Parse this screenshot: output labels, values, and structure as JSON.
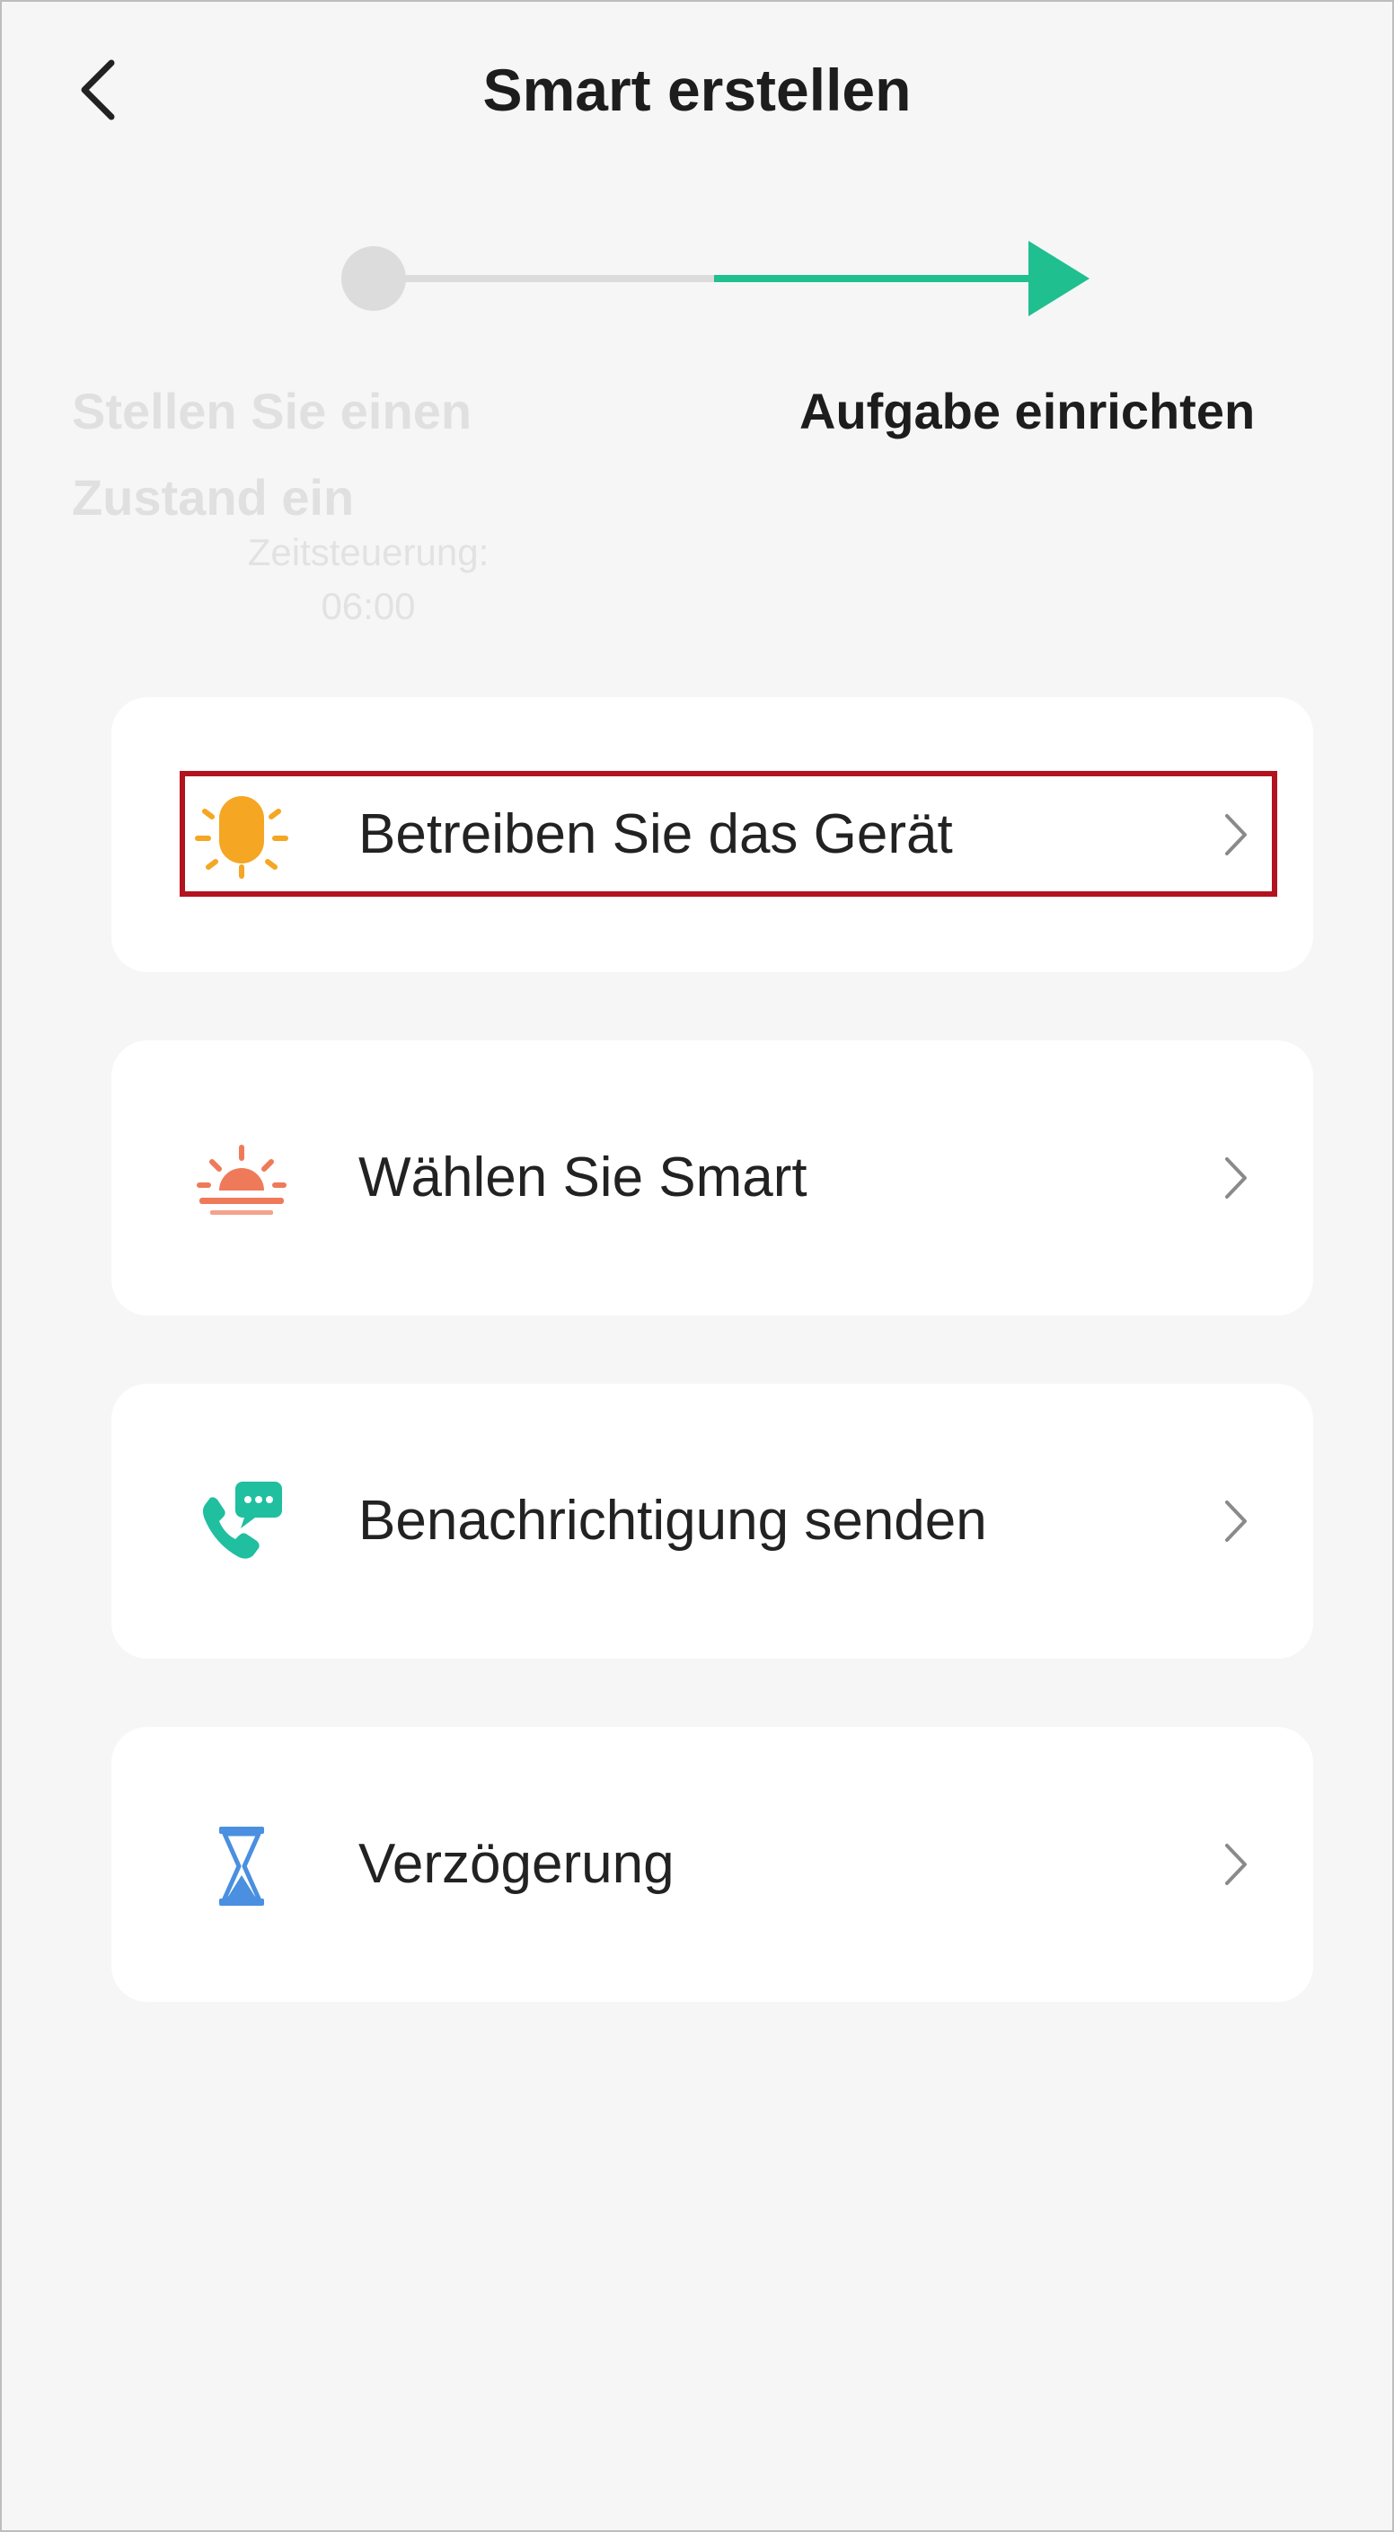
{
  "header": {
    "title": "Smart erstellen",
    "back_icon": "chevron-left-icon"
  },
  "stepper": {
    "step1": {
      "label": "Stellen Sie einen Zustand ein",
      "sub_line1": "Zeitsteuerung:",
      "sub_line2": "06:00",
      "state": "completed"
    },
    "step2": {
      "label": "Aufgabe einrichten",
      "state": "active"
    },
    "active_color": "#1fbf8f",
    "inactive_color": "#dcdcdc"
  },
  "actions": [
    {
      "label": "Betreiben Sie das Gerät",
      "icon": "sun-device-icon",
      "color": "#f5a623",
      "highlighted": true
    },
    {
      "label": "Wählen Sie Smart",
      "icon": "sunrise-icon",
      "color": "#ef7a5a",
      "highlighted": false
    },
    {
      "label": "Benachrichtigung senden",
      "icon": "phone-message-icon",
      "color": "#1fbf9f",
      "highlighted": false
    },
    {
      "label": "Verzögerung",
      "icon": "hourglass-icon",
      "color": "#4a8fe0",
      "highlighted": false
    }
  ],
  "highlight_color": "#b3121f"
}
